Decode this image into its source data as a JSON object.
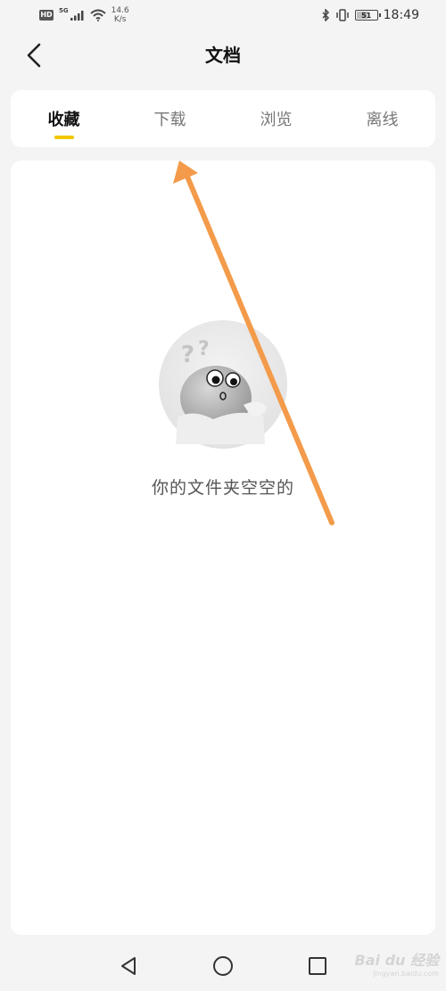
{
  "status_bar": {
    "hd": "HD",
    "network": "5G",
    "speed_value": "14.6",
    "speed_unit": "K/s",
    "battery": "51",
    "time": "18:49"
  },
  "header": {
    "title": "文档",
    "back_icon": "chevron-left-icon"
  },
  "tabs": [
    {
      "label": "收藏",
      "active": true
    },
    {
      "label": "下载",
      "active": false
    },
    {
      "label": "浏览",
      "active": false
    },
    {
      "label": "离线",
      "active": false
    }
  ],
  "empty_state": {
    "message": "你的文件夹空空的",
    "icon": "confused-mascot-icon"
  },
  "colors": {
    "accent": "#f2c600",
    "arrow": "#f39b4a",
    "background": "#f4f4f4",
    "card": "#ffffff"
  },
  "nav_bar": {
    "back_icon": "triangle-back-icon",
    "home_icon": "circle-home-icon",
    "recent_icon": "square-recent-icon"
  },
  "watermark": {
    "main": "Bai du 经验",
    "sub": "jingyan.baidu.com"
  }
}
